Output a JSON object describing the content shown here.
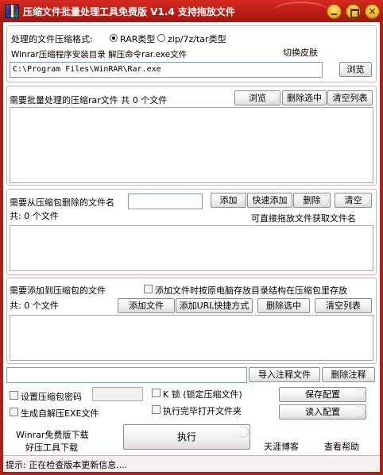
{
  "window": {
    "title": "压缩文件批量处理工具免费版 V1.4   支持拖放文件"
  },
  "format": {
    "label": "处理的文件压缩格式:",
    "option_rar": "RAR类型",
    "option_zip": "zip/7z/tar类型",
    "winrar_dir_label": "Winrar压缩程序安装目录 解压命令rar.exe文件",
    "skin_label": "切换皮肤",
    "path_value": "C:\\Program Files\\WinRAR\\Rar.exe",
    "browse": "浏览"
  },
  "files": {
    "label": "需要批量处理的压缩rar文件 共 0 个文件",
    "browse": "浏览",
    "delete_selected": "删除选中",
    "clear_list": "清空列表"
  },
  "remove": {
    "label": "需要从压缩包删除的文件名",
    "add": "添加",
    "quick_add": "快速添加",
    "delete": "删除",
    "clear": "清空",
    "count": "共: 0 个文件",
    "drag_hint": "可直接拖放文件获取文件名"
  },
  "add_files": {
    "label": "需要添加到压缩包的文件",
    "keep_structure": "添加文件时按原电脑存放目录结构在压缩包里存放",
    "count": "共: 0 个文件",
    "add_file": "添加文件",
    "add_url": "添加URL快捷方式",
    "delete_selected": "删除选中",
    "clear_list": "清空列表"
  },
  "comment": {
    "import": "导入注释文件",
    "delete": "删除注释"
  },
  "options": {
    "set_password": "设置压缩包密码",
    "make_sfx": "生成自解压EXE文件",
    "lock": "K 锁 (锁定压缩文件)",
    "open_folder": "执行完毕打开文件夹",
    "save_config": "保存配置",
    "load_config": "读入配置"
  },
  "footer": {
    "winrar_download": "Winrar免费版下载",
    "haoxia_download": "好压工具下载",
    "execute": "执行",
    "blog": "天涯博客",
    "help": "查看帮助"
  },
  "status": {
    "text": "提示: 正在检查版本更新信息...."
  }
}
